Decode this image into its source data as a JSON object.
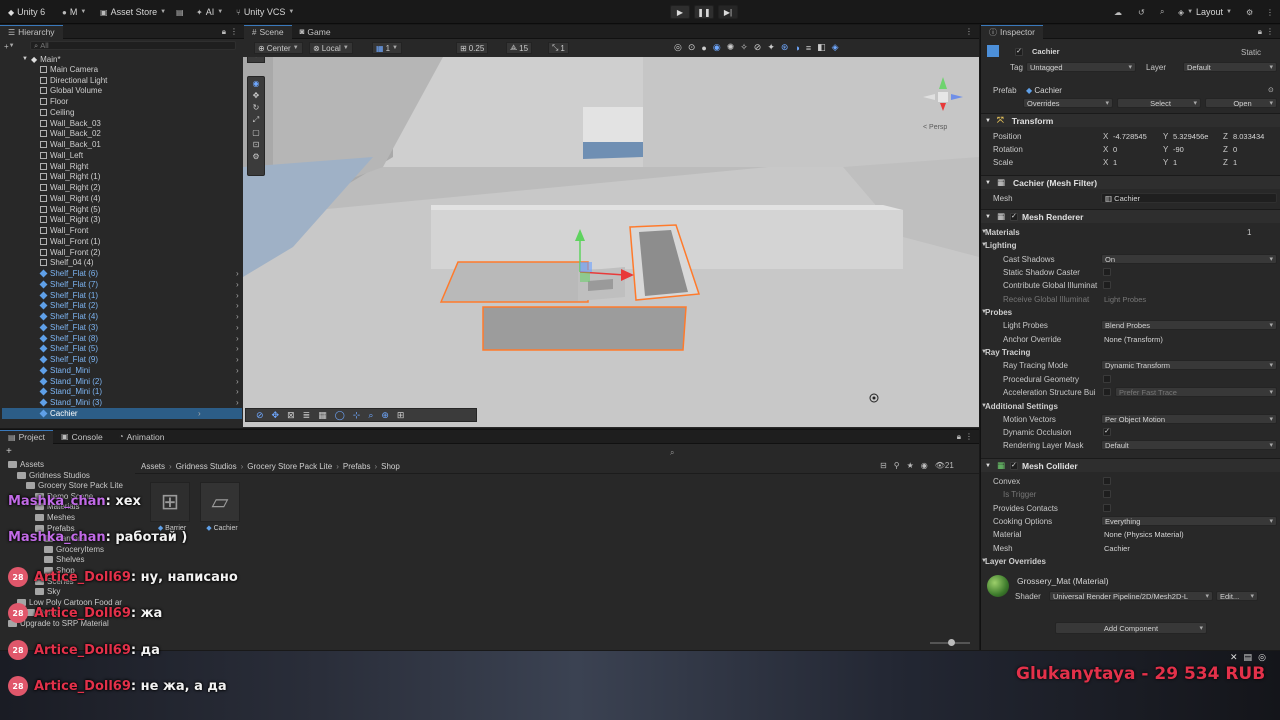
{
  "topbar": {
    "unity_label": "Unity 6",
    "account_label": "M",
    "asset_store_label": "Asset Store",
    "ai_label": "AI",
    "vcs_label": "Unity VCS",
    "layout_label": "Layout"
  },
  "hierarchy": {
    "tab_label": "Hierarchy",
    "search_placeholder": "All",
    "scene_name": "Main*",
    "items": [
      {
        "label": "Main Camera",
        "prefab": false
      },
      {
        "label": "Directional Light",
        "prefab": false
      },
      {
        "label": "Global Volume",
        "prefab": false
      },
      {
        "label": "Floor",
        "prefab": false
      },
      {
        "label": "Ceiling",
        "prefab": false
      },
      {
        "label": "Wall_Back_03",
        "prefab": false
      },
      {
        "label": "Wall_Back_02",
        "prefab": false
      },
      {
        "label": "Wall_Back_01",
        "prefab": false
      },
      {
        "label": "Wall_Left",
        "prefab": false
      },
      {
        "label": "Wall_Right",
        "prefab": false
      },
      {
        "label": "Wall_Right (1)",
        "prefab": false
      },
      {
        "label": "Wall_Right (2)",
        "prefab": false
      },
      {
        "label": "Wall_Right (4)",
        "prefab": false
      },
      {
        "label": "Wall_Right (5)",
        "prefab": false
      },
      {
        "label": "Wall_Right (3)",
        "prefab": false
      },
      {
        "label": "Wall_Front",
        "prefab": false
      },
      {
        "label": "Wall_Front (1)",
        "prefab": false
      },
      {
        "label": "Wall_Front (2)",
        "prefab": false
      },
      {
        "label": "Shelf_04 (4)",
        "prefab": false
      },
      {
        "label": "Shelf_Flat (6)",
        "prefab": true
      },
      {
        "label": "Shelf_Flat (7)",
        "prefab": true
      },
      {
        "label": "Shelf_Flat (1)",
        "prefab": true
      },
      {
        "label": "Shelf_Flat (2)",
        "prefab": true
      },
      {
        "label": "Shelf_Flat (4)",
        "prefab": true
      },
      {
        "label": "Shelf_Flat (3)",
        "prefab": true
      },
      {
        "label": "Shelf_Flat (8)",
        "prefab": true
      },
      {
        "label": "Shelf_Flat (5)",
        "prefab": true
      },
      {
        "label": "Shelf_Flat (9)",
        "prefab": true
      },
      {
        "label": "Stand_Mini",
        "prefab": true
      },
      {
        "label": "Stand_Mini (2)",
        "prefab": true
      },
      {
        "label": "Stand_Mini (1)",
        "prefab": true
      },
      {
        "label": "Stand_Mini (3)",
        "prefab": true
      },
      {
        "label": "Cachier",
        "prefab": true,
        "selected": true
      }
    ]
  },
  "scene": {
    "tab_scene": "Scene",
    "tab_game": "Game",
    "pivot_label": "Center",
    "space_label": "Local",
    "grid_value": "1",
    "snap_value": "0.25",
    "angle_value": "15",
    "scale_value": "1",
    "persp_label": "< Persp"
  },
  "inspector": {
    "tab_label": "Inspector",
    "object_name": "Cachier",
    "static_label": "Static",
    "tag_label": "Tag",
    "tag_value": "Untagged",
    "layer_label": "Layer",
    "layer_value": "Default",
    "prefab_label": "Prefab",
    "prefab_value": "Cachier",
    "overrides_label": "Overrides",
    "select_label": "Select",
    "open_label": "Open",
    "transform": {
      "title": "Transform",
      "position_label": "Position",
      "rotation_label": "Rotation",
      "scale_label": "Scale",
      "position": {
        "x": "-4.728545",
        "y": "5.329456e",
        "z": "8.033434"
      },
      "rotation": {
        "x": "0",
        "y": "-90",
        "z": "0"
      },
      "scale": {
        "x": "1",
        "y": "1",
        "z": "1"
      }
    },
    "mesh_filter": {
      "title": "Cachier (Mesh Filter)",
      "mesh_label": "Mesh",
      "mesh_value": "Cachier"
    },
    "mesh_renderer": {
      "title": "Mesh Renderer",
      "materials_label": "Materials",
      "materials_count": "1",
      "lighting_label": "Lighting",
      "cast_shadows_label": "Cast Shadows",
      "cast_shadows_value": "On",
      "static_shadow_label": "Static Shadow Caster",
      "contribute_gi_label": "Contribute Global Illuminat",
      "receive_gi_label": "Receive Global Illuminat",
      "receive_gi_value": "Light Probes",
      "probes_label": "Probes",
      "light_probes_label": "Light Probes",
      "light_probes_value": "Blend Probes",
      "anchor_label": "Anchor Override",
      "anchor_value": "None (Transform)",
      "ray_tracing_label": "Ray Tracing",
      "ray_mode_label": "Ray Tracing Mode",
      "ray_mode_value": "Dynamic Transform",
      "proc_geo_label": "Procedural Geometry",
      "accel_label": "Acceleration Structure Bui",
      "accel_value": "Prefer Fast Trace",
      "additional_label": "Additional Settings",
      "motion_label": "Motion Vectors",
      "motion_value": "Per Object Motion",
      "occlusion_label": "Dynamic Occlusion",
      "render_mask_label": "Rendering Layer Mask",
      "render_mask_value": "Default"
    },
    "mesh_collider": {
      "title": "Mesh Collider",
      "convex_label": "Convex",
      "trigger_label": "Is Trigger",
      "contacts_label": "Provides Contacts",
      "cooking_label": "Cooking Options",
      "cooking_value": "Everything",
      "material_label": "Material",
      "material_value": "None (Physics Material)",
      "mesh_label": "Mesh",
      "mesh_value": "Cachier",
      "layer_overrides_label": "Layer Overrides"
    },
    "material": {
      "name": "Grossery_Mat (Material)",
      "shader_label": "Shader",
      "shader_value": "Universal Render Pipeline/2D/Mesh2D-L",
      "edit_label": "Edit..."
    },
    "add_component_label": "Add Component"
  },
  "project": {
    "tab_project": "Project",
    "tab_console": "Console",
    "tab_animation": "Animation",
    "breadcrumb": [
      "Assets",
      "Gridness Studios",
      "Grocery Store Pack Lite",
      "Prefabs",
      "Shop"
    ],
    "tree": [
      {
        "label": "Assets",
        "indent": 0
      },
      {
        "label": "Gridness Studios",
        "indent": 1
      },
      {
        "label": "Grocery Store Pack Lite",
        "indent": 2
      },
      {
        "label": "Demo Scene",
        "indent": 3
      },
      {
        "label": "Materials",
        "indent": 3
      },
      {
        "label": "Meshes",
        "indent": 3
      },
      {
        "label": "Prefabs",
        "indent": 3
      },
      {
        "label": "Carriers",
        "indent": 4
      },
      {
        "label": "GroceryItems",
        "indent": 4
      },
      {
        "label": "Shelves",
        "indent": 4
      },
      {
        "label": "Shop",
        "indent": 4
      },
      {
        "label": "Scenes",
        "indent": 3
      },
      {
        "label": "Sky",
        "indent": 3
      },
      {
        "label": "Low Poly Cartoon Food ar",
        "indent": 1
      },
      {
        "label": "Demo",
        "indent": 2
      },
      {
        "label": "Upgrade to SRP Material",
        "indent": 0
      }
    ],
    "assets": [
      {
        "label": "Barrier"
      },
      {
        "label": "Cachier"
      }
    ],
    "item_count": "21"
  },
  "chat": [
    {
      "user": "Mashka_chan",
      "text": ": хех",
      "badge": ""
    },
    {
      "user": "Mashka_chan",
      "text": ": работай )",
      "badge": ""
    },
    {
      "user": "Artice_Doll69",
      "text": ": ну, написано",
      "badge": "28"
    },
    {
      "user": "Artice_Doll69",
      "text": ": жа",
      "badge": "28"
    },
    {
      "user": "Artice_Doll69",
      "text": ": да",
      "badge": "28"
    },
    {
      "user": "Artice_Doll69",
      "text": ": не жа, а да",
      "badge": "28"
    }
  ],
  "donation": {
    "text": "Glukanytaya - 29 534 RUB"
  }
}
